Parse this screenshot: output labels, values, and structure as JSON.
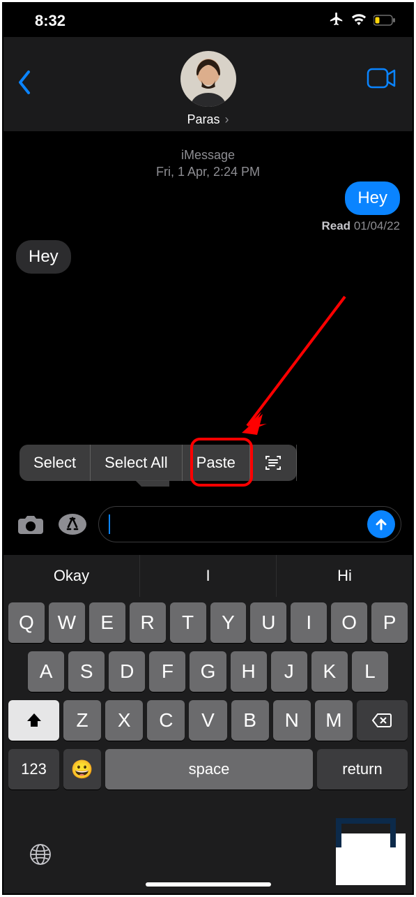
{
  "status": {
    "time": "8:32"
  },
  "header": {
    "contact": "Paras"
  },
  "thread": {
    "service": "iMessage",
    "timestamp": "Fri, 1 Apr, 2:24 PM",
    "outgoing": "Hey",
    "read_label": "Read",
    "read_date": "01/04/22",
    "incoming": "Hey"
  },
  "menu": {
    "select": "Select",
    "select_all": "Select All",
    "paste": "Paste"
  },
  "quicktype": {
    "s1": "Okay",
    "s2": "I",
    "s3": "Hi"
  },
  "keys": {
    "r1": [
      "Q",
      "W",
      "E",
      "R",
      "T",
      "Y",
      "U",
      "I",
      "O",
      "P"
    ],
    "r2": [
      "A",
      "S",
      "D",
      "F",
      "G",
      "H",
      "J",
      "K",
      "L"
    ],
    "r3": [
      "Z",
      "X",
      "C",
      "V",
      "B",
      "N",
      "M"
    ],
    "num": "123",
    "space": "space",
    "return": "return"
  }
}
